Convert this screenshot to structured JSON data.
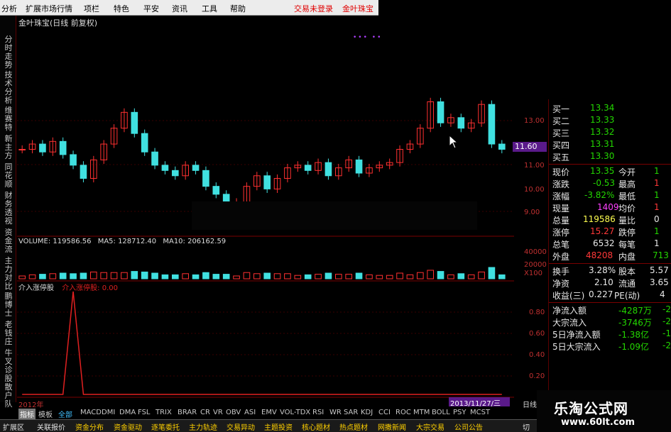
{
  "menu": {
    "items": [
      "分析",
      "扩展市场行情",
      "项栏",
      "特色",
      "平安",
      "资讯",
      "工具",
      "帮助"
    ],
    "status_login": "交易未登录",
    "status_stock": "金叶珠宝"
  },
  "left_sidebar": [
    "分时走势",
    "技术分析",
    "维赛特",
    "新主方",
    "同花顺",
    "财务透视",
    "资金流",
    "主力对比",
    "鹏博士",
    "老钱庄",
    "牛叉诊股",
    "散户队"
  ],
  "chart": {
    "title": "金叶珠宝(日线 前复权)",
    "price_ticks": [
      "13.00",
      "12.00",
      "11.00",
      "10.00",
      "9.00"
    ],
    "current_price_badge": "11.60",
    "volume_header": [
      "VOLUME: 119586.56",
      "MA5: 128712.40",
      "MA10: 206162.59"
    ],
    "volume_ticks": [
      "40000",
      "20000",
      "X100"
    ],
    "indicator_name": "介入涨停股",
    "indicator_value": "介入涨停股: 0.00",
    "indicator_ticks": [
      "0.80",
      "0.60",
      "0.40",
      "0.20"
    ],
    "date_start": "2012年",
    "date_end": "2013/11/27/三",
    "period_label": "日线"
  },
  "chart_data": {
    "type": "line",
    "title": "金叶珠宝(日线 前复权)",
    "xlabel": "",
    "ylabel": "",
    "ylim": [
      8.5,
      13.6
    ],
    "series": [
      {
        "name": "",
        "values": [
          11.6,
          11.8,
          11.5,
          11.9,
          11.4,
          11.0,
          10.5,
          11.2,
          11.8,
          12.4,
          13.0,
          12.2,
          11.5,
          11.0,
          10.8,
          10.6,
          11.0,
          10.8,
          10.2,
          9.9,
          9.6,
          9.6,
          10.2,
          10.6,
          10.1,
          10.5,
          10.9,
          11.0,
          10.8,
          11.1,
          10.6,
          10.9,
          11.2,
          10.7,
          10.9,
          11.0,
          11.1,
          11.6,
          11.8,
          12.4,
          13.4,
          12.6,
          12.8,
          12.4,
          12.6,
          13.3,
          11.8,
          11.6
        ]
      }
    ],
    "indicator": {
      "name": "介入涨停股",
      "values": [
        0,
        0,
        0,
        0,
        0,
        1,
        0,
        0,
        0,
        0,
        0,
        0,
        0,
        0,
        0,
        0,
        0,
        0,
        0,
        0,
        0,
        0,
        0,
        0,
        0,
        0,
        0,
        0,
        0,
        0,
        0,
        0,
        0,
        0,
        0,
        0,
        0,
        0,
        0,
        0,
        0,
        0,
        0,
        0,
        0,
        0,
        0,
        0
      ]
    }
  },
  "quote": {
    "bids": [
      {
        "label": "买一",
        "price": "13.34"
      },
      {
        "label": "买二",
        "price": "13.33"
      },
      {
        "label": "买三",
        "price": "13.32"
      },
      {
        "label": "买四",
        "price": "13.31"
      },
      {
        "label": "买五",
        "price": "13.30"
      }
    ],
    "stats": [
      {
        "l1": "现价",
        "v1": "13.35",
        "l2": "今开",
        "v2": "1"
      },
      {
        "l1": "涨跌",
        "v1": "-0.53",
        "l2": "最高",
        "v2": "1"
      },
      {
        "l1": "涨幅",
        "v1": "-3.82%",
        "l2": "最低",
        "v2": "1"
      },
      {
        "l1": "现量",
        "v1": "1409",
        "l2": "均价",
        "v2": "1"
      },
      {
        "l1": "总量",
        "v1": "119586",
        "l2": "量比",
        "v2": "0"
      },
      {
        "l1": "涨停",
        "v1": "15.27",
        "l2": "跌停",
        "v2": "1"
      },
      {
        "l1": "总笔",
        "v1": "6532",
        "l2": "每笔",
        "v2": "1"
      },
      {
        "l1": "外盘",
        "v1": "48208",
        "l2": "内盘",
        "v2": "713"
      }
    ],
    "stats2": [
      {
        "l1": "换手",
        "v1": "3.28%",
        "l2": "股本",
        "v2": "5.57"
      },
      {
        "l1": "净资",
        "v1": "2.10",
        "l2": "流通",
        "v2": "3.65"
      },
      {
        "l1": "收益(三)",
        "v1": "0.227",
        "l2": "PE(动)",
        "v2": "4"
      }
    ],
    "flows": [
      {
        "l": "净流入额",
        "v": "-4287万",
        "x": "-2"
      },
      {
        "l": "大宗流入",
        "v": "-3746万",
        "x": "-2"
      },
      {
        "l": "5日净流入额",
        "v": "-1.38亿",
        "x": "-1"
      },
      {
        "l": "5日大宗流入",
        "v": "-1.09亿",
        "x": "-2"
      }
    ]
  },
  "indicator_tabs": [
    "指标",
    "模板",
    "全部",
    "MACD",
    "DMI",
    "DMA",
    "FSL",
    "TRIX",
    "BRAR",
    "CR",
    "VR",
    "OBV",
    "ASI",
    "EMV",
    "VOL-TDX",
    "RSI",
    "WR",
    "SAR",
    "KDJ",
    "CCI",
    "ROC",
    "MTM",
    "BOLL",
    "PSY",
    "MCST"
  ],
  "bottom_tabs": [
    "扩展区",
    "关联报价",
    "资金分布",
    "资金驱动",
    "逐笔委托",
    "主力轨迹",
    "交易异动",
    "主题投资",
    "核心题材",
    "热点题材",
    "网撒新闻",
    "大宗交易",
    "公司公告",
    "切"
  ],
  "watermark": {
    "name": "乐淘公式网",
    "url": "www.60lt.com"
  }
}
